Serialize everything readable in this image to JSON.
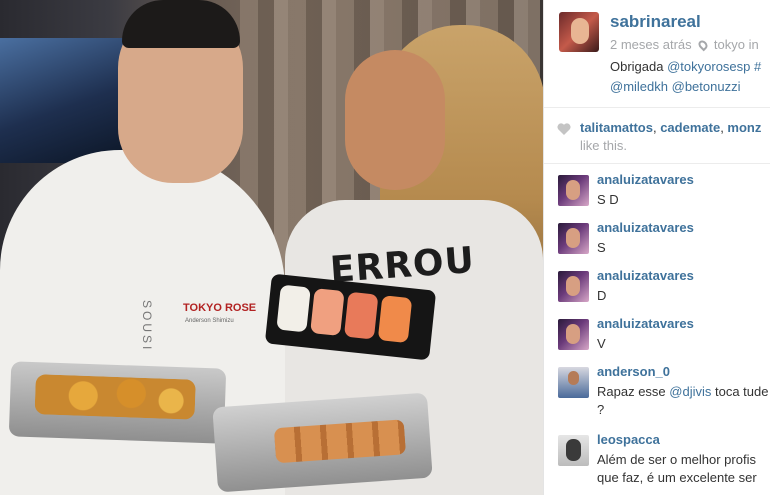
{
  "photo": {
    "shirt_print": "ERROU",
    "chef_logo": "TOKYO ROSE",
    "chef_name": "Anderson Shimizu",
    "chef_vertical": "SOUSI"
  },
  "post": {
    "owner": "sabrinareal",
    "time": "2 meses atrás",
    "location": "tokyo in",
    "caption_text": "Obrigada",
    "caption_mentions": [
      "@tokyorosesp",
      "#"
    ],
    "caption_line2": [
      "@miledkh",
      "@betonuzzi"
    ]
  },
  "likes": {
    "users": [
      "talitamattos",
      "cademate",
      "monz"
    ],
    "suffix": "like this."
  },
  "comments": [
    {
      "user": "analuizatavares",
      "text": "S D",
      "avatar": "ana"
    },
    {
      "user": "analuizatavares",
      "text": "S",
      "avatar": "ana"
    },
    {
      "user": "analuizatavares",
      "text": "D",
      "avatar": "ana"
    },
    {
      "user": "analuizatavares",
      "text": "V",
      "avatar": "ana"
    },
    {
      "user": "anderson_0",
      "text_before": "Rapaz esse",
      "mention": "@djivis",
      "text_after": "toca tude",
      "line2": "?",
      "avatar": "and"
    },
    {
      "user": "leospacca",
      "line1": "Além de ser o melhor profis",
      "line2": "que faz, é um excelente ser",
      "avatar": "leo"
    }
  ],
  "colors": {
    "link": "#3f729b",
    "muted": "#a5a7aa",
    "text": "#333333"
  }
}
